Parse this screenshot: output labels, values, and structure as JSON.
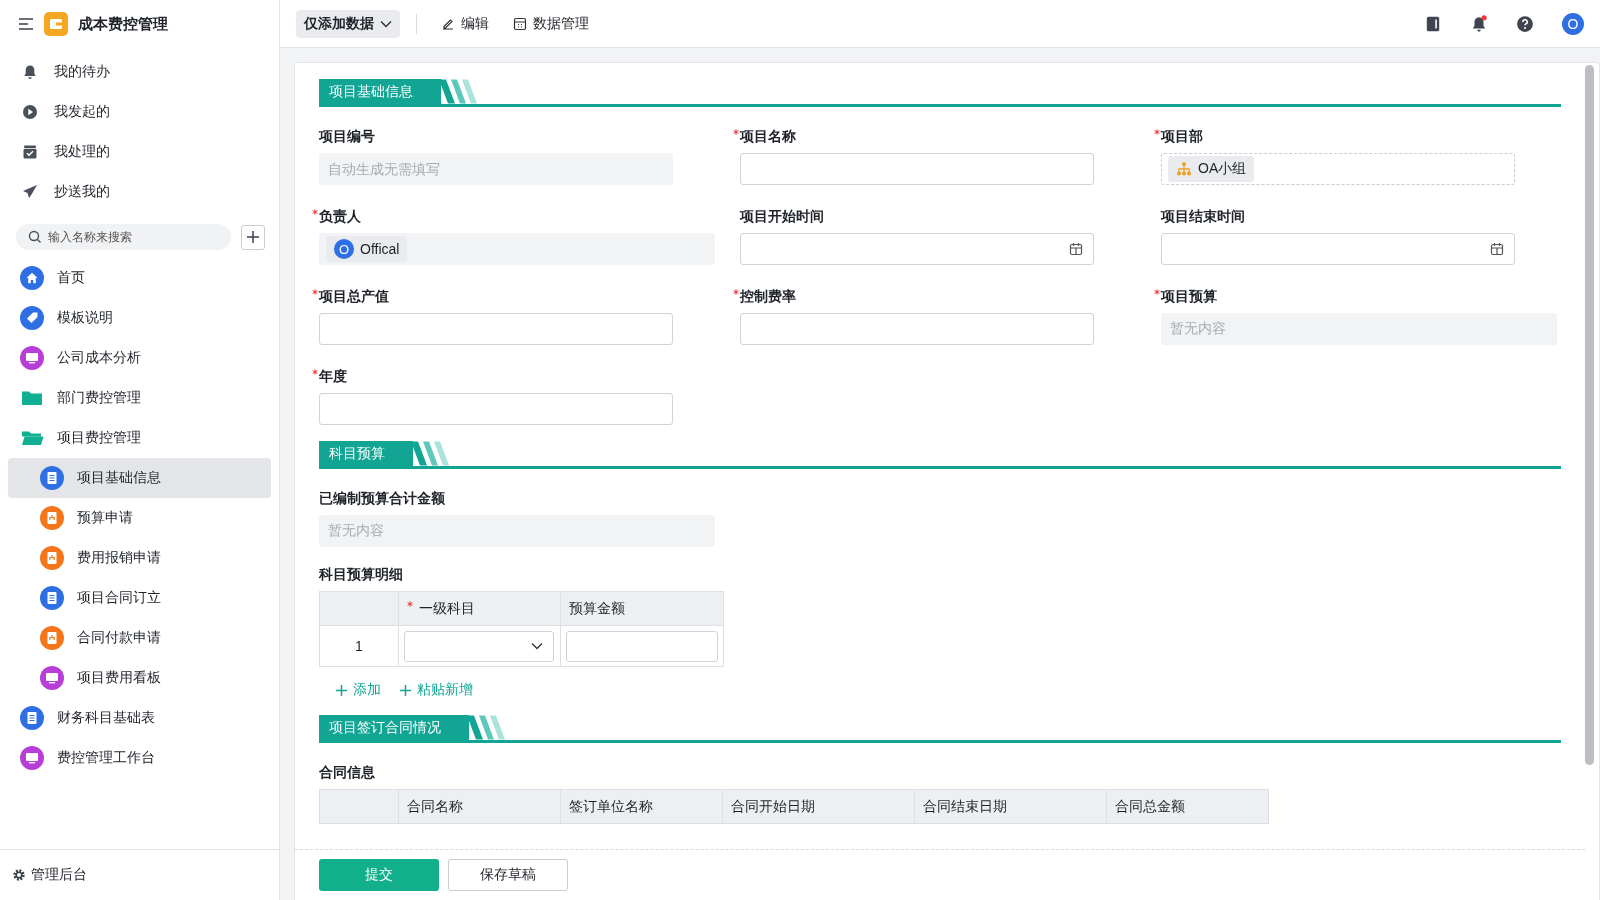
{
  "app": {
    "title": "成本费控管理"
  },
  "sidebar": {
    "quick_links": [
      {
        "label": "我的待办",
        "kind": "bell"
      },
      {
        "label": "我发起的",
        "kind": "play"
      },
      {
        "label": "我处理的",
        "kind": "inbox"
      },
      {
        "label": "抄送我的",
        "kind": "send"
      }
    ],
    "search": {
      "placeholder": "输入名称来搜索"
    },
    "tree": [
      {
        "label": "首页",
        "kind": "home",
        "selected": false
      },
      {
        "label": "模板说明",
        "kind": "tag",
        "selected": false
      },
      {
        "label": "公司成本分析",
        "kind": "screen",
        "selected": false
      },
      {
        "label": "部门费控管理",
        "kind": "folder",
        "selected": false,
        "expanded": false
      },
      {
        "label": "项目费控管理",
        "kind": "folder",
        "selected": false,
        "expanded": true,
        "children": [
          {
            "label": "项目基础信息",
            "kind": "doc",
            "selected": true
          },
          {
            "label": "预算申请",
            "kind": "flow",
            "selected": false
          },
          {
            "label": "费用报销申请",
            "kind": "flow",
            "selected": false
          },
          {
            "label": "项目合同订立",
            "kind": "doc",
            "selected": false
          },
          {
            "label": "合同付款申请",
            "kind": "flow",
            "selected": false
          },
          {
            "label": "项目费用看板",
            "kind": "screen",
            "selected": false
          }
        ]
      },
      {
        "label": "财务科目基础表",
        "kind": "doc",
        "selected": false
      },
      {
        "label": "费控管理工作台",
        "kind": "screen",
        "selected": false
      }
    ],
    "footer_link": "管理后台"
  },
  "topbar": {
    "mode": "仅添加数据",
    "actions": [
      {
        "label": "编辑",
        "kind": "edit"
      },
      {
        "label": "数据管理",
        "kind": "table"
      }
    ],
    "notification_dot": true,
    "avatar": "O"
  },
  "sections": [
    {
      "title": "项目基础信息",
      "fields": [
        {
          "label": "项目编号",
          "required": false,
          "kind": "readonly",
          "placeholder": "自动生成无需填写"
        },
        {
          "label": "项目名称",
          "required": true,
          "kind": "input"
        },
        {
          "label": "项目部",
          "required": true,
          "kind": "dept",
          "value": "OA小组"
        },
        {
          "label": "负责人",
          "required": true,
          "kind": "member",
          "value": "Offical",
          "initial": "O"
        },
        {
          "label": "项目开始时间",
          "required": false,
          "kind": "date"
        },
        {
          "label": "项目结束时间",
          "required": false,
          "kind": "date"
        },
        {
          "label": "项目总产值",
          "required": true,
          "kind": "input"
        },
        {
          "label": "控制费率",
          "required": true,
          "kind": "input"
        },
        {
          "label": "项目预算",
          "required": true,
          "kind": "display",
          "placeholder": "暂无内容"
        },
        {
          "label": "年度",
          "required": true,
          "kind": "input"
        }
      ]
    },
    {
      "title": "科目预算",
      "fields": [
        {
          "label": "已编制预算合计金额",
          "required": false,
          "kind": "display",
          "placeholder": "暂无内容"
        }
      ],
      "table": {
        "label": "科目预算明细",
        "columns": [
          {
            "label": "一级科目",
            "required": true
          },
          {
            "label": "预算金额",
            "required": false
          }
        ],
        "rows": [
          {
            "index": "1",
            "cells": [
              {
                "kind": "select"
              },
              {
                "kind": "input"
              }
            ]
          }
        ],
        "actions": [
          "添加",
          "粘贴新增"
        ]
      }
    },
    {
      "title": "项目签订合同情况",
      "table": {
        "label": "合同信息",
        "columns": [
          {
            "label": "合同名称",
            "required": false
          },
          {
            "label": "签订单位名称",
            "required": false
          },
          {
            "label": "合同开始日期",
            "required": false
          },
          {
            "label": "合同结束日期",
            "required": false
          },
          {
            "label": "合同总金额",
            "required": false
          }
        ]
      }
    }
  ],
  "footer_buttons": [
    {
      "label": "提交",
      "kind": "primary"
    },
    {
      "label": "保存草稿",
      "kind": "default"
    }
  ]
}
